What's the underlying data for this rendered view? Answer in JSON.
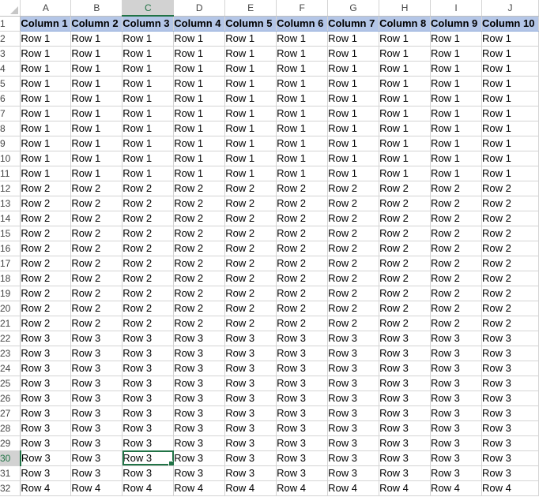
{
  "sheet": {
    "column_letters": [
      "A",
      "B",
      "C",
      "D",
      "E",
      "F",
      "G",
      "H",
      "I",
      "J"
    ],
    "active_column": "C",
    "active_row": 30,
    "selected_cell": "C30",
    "rows": [
      {
        "n": 1,
        "cells": [
          "Column 1",
          "Column 2",
          "Column 3",
          "Column 4",
          "Column 5",
          "Column 6",
          "Column 7",
          "Column 8",
          "Column 9",
          "Column 10"
        ]
      },
      {
        "n": 2,
        "cells": [
          "Row 1",
          "Row 1",
          "Row 1",
          "Row 1",
          "Row 1",
          "Row 1",
          "Row 1",
          "Row 1",
          "Row 1",
          "Row 1"
        ]
      },
      {
        "n": 3,
        "cells": [
          "Row 1",
          "Row 1",
          "Row 1",
          "Row 1",
          "Row 1",
          "Row 1",
          "Row 1",
          "Row 1",
          "Row 1",
          "Row 1"
        ]
      },
      {
        "n": 4,
        "cells": [
          "Row 1",
          "Row 1",
          "Row 1",
          "Row 1",
          "Row 1",
          "Row 1",
          "Row 1",
          "Row 1",
          "Row 1",
          "Row 1"
        ]
      },
      {
        "n": 5,
        "cells": [
          "Row 1",
          "Row 1",
          "Row 1",
          "Row 1",
          "Row 1",
          "Row 1",
          "Row 1",
          "Row 1",
          "Row 1",
          "Row 1"
        ]
      },
      {
        "n": 6,
        "cells": [
          "Row 1",
          "Row 1",
          "Row 1",
          "Row 1",
          "Row 1",
          "Row 1",
          "Row 1",
          "Row 1",
          "Row 1",
          "Row 1"
        ]
      },
      {
        "n": 7,
        "cells": [
          "Row 1",
          "Row 1",
          "Row 1",
          "Row 1",
          "Row 1",
          "Row 1",
          "Row 1",
          "Row 1",
          "Row 1",
          "Row 1"
        ]
      },
      {
        "n": 8,
        "cells": [
          "Row 1",
          "Row 1",
          "Row 1",
          "Row 1",
          "Row 1",
          "Row 1",
          "Row 1",
          "Row 1",
          "Row 1",
          "Row 1"
        ]
      },
      {
        "n": 9,
        "cells": [
          "Row 1",
          "Row 1",
          "Row 1",
          "Row 1",
          "Row 1",
          "Row 1",
          "Row 1",
          "Row 1",
          "Row 1",
          "Row 1"
        ]
      },
      {
        "n": 10,
        "cells": [
          "Row 1",
          "Row 1",
          "Row 1",
          "Row 1",
          "Row 1",
          "Row 1",
          "Row 1",
          "Row 1",
          "Row 1",
          "Row 1"
        ]
      },
      {
        "n": 11,
        "cells": [
          "Row 1",
          "Row 1",
          "Row 1",
          "Row 1",
          "Row 1",
          "Row 1",
          "Row 1",
          "Row 1",
          "Row 1",
          "Row 1"
        ]
      },
      {
        "n": 12,
        "cells": [
          "Row 2",
          "Row 2",
          "Row 2",
          "Row 2",
          "Row 2",
          "Row 2",
          "Row 2",
          "Row 2",
          "Row 2",
          "Row 2"
        ]
      },
      {
        "n": 13,
        "cells": [
          "Row 2",
          "Row 2",
          "Row 2",
          "Row 2",
          "Row 2",
          "Row 2",
          "Row 2",
          "Row 2",
          "Row 2",
          "Row 2"
        ]
      },
      {
        "n": 14,
        "cells": [
          "Row 2",
          "Row 2",
          "Row 2",
          "Row 2",
          "Row 2",
          "Row 2",
          "Row 2",
          "Row 2",
          "Row 2",
          "Row 2"
        ]
      },
      {
        "n": 15,
        "cells": [
          "Row 2",
          "Row 2",
          "Row 2",
          "Row 2",
          "Row 2",
          "Row 2",
          "Row 2",
          "Row 2",
          "Row 2",
          "Row 2"
        ]
      },
      {
        "n": 16,
        "cells": [
          "Row 2",
          "Row 2",
          "Row 2",
          "Row 2",
          "Row 2",
          "Row 2",
          "Row 2",
          "Row 2",
          "Row 2",
          "Row 2"
        ]
      },
      {
        "n": 17,
        "cells": [
          "Row 2",
          "Row 2",
          "Row 2",
          "Row 2",
          "Row 2",
          "Row 2",
          "Row 2",
          "Row 2",
          "Row 2",
          "Row 2"
        ]
      },
      {
        "n": 18,
        "cells": [
          "Row 2",
          "Row 2",
          "Row 2",
          "Row 2",
          "Row 2",
          "Row 2",
          "Row 2",
          "Row 2",
          "Row 2",
          "Row 2"
        ]
      },
      {
        "n": 19,
        "cells": [
          "Row 2",
          "Row 2",
          "Row 2",
          "Row 2",
          "Row 2",
          "Row 2",
          "Row 2",
          "Row 2",
          "Row 2",
          "Row 2"
        ]
      },
      {
        "n": 20,
        "cells": [
          "Row 2",
          "Row 2",
          "Row 2",
          "Row 2",
          "Row 2",
          "Row 2",
          "Row 2",
          "Row 2",
          "Row 2",
          "Row 2"
        ]
      },
      {
        "n": 21,
        "cells": [
          "Row 2",
          "Row 2",
          "Row 2",
          "Row 2",
          "Row 2",
          "Row 2",
          "Row 2",
          "Row 2",
          "Row 2",
          "Row 2"
        ]
      },
      {
        "n": 22,
        "cells": [
          "Row 3",
          "Row 3",
          "Row 3",
          "Row 3",
          "Row 3",
          "Row 3",
          "Row 3",
          "Row 3",
          "Row 3",
          "Row 3"
        ]
      },
      {
        "n": 23,
        "cells": [
          "Row 3",
          "Row 3",
          "Row 3",
          "Row 3",
          "Row 3",
          "Row 3",
          "Row 3",
          "Row 3",
          "Row 3",
          "Row 3"
        ]
      },
      {
        "n": 24,
        "cells": [
          "Row 3",
          "Row 3",
          "Row 3",
          "Row 3",
          "Row 3",
          "Row 3",
          "Row 3",
          "Row 3",
          "Row 3",
          "Row 3"
        ]
      },
      {
        "n": 25,
        "cells": [
          "Row 3",
          "Row 3",
          "Row 3",
          "Row 3",
          "Row 3",
          "Row 3",
          "Row 3",
          "Row 3",
          "Row 3",
          "Row 3"
        ]
      },
      {
        "n": 26,
        "cells": [
          "Row 3",
          "Row 3",
          "Row 3",
          "Row 3",
          "Row 3",
          "Row 3",
          "Row 3",
          "Row 3",
          "Row 3",
          "Row 3"
        ]
      },
      {
        "n": 27,
        "cells": [
          "Row 3",
          "Row 3",
          "Row 3",
          "Row 3",
          "Row 3",
          "Row 3",
          "Row 3",
          "Row 3",
          "Row 3",
          "Row 3"
        ]
      },
      {
        "n": 28,
        "cells": [
          "Row 3",
          "Row 3",
          "Row 3",
          "Row 3",
          "Row 3",
          "Row 3",
          "Row 3",
          "Row 3",
          "Row 3",
          "Row 3"
        ]
      },
      {
        "n": 29,
        "cells": [
          "Row 3",
          "Row 3",
          "Row 3",
          "Row 3",
          "Row 3",
          "Row 3",
          "Row 3",
          "Row 3",
          "Row 3",
          "Row 3"
        ]
      },
      {
        "n": 30,
        "cells": [
          "Row 3",
          "Row 3",
          "Row 3",
          "Row 3",
          "Row 3",
          "Row 3",
          "Row 3",
          "Row 3",
          "Row 3",
          "Row 3"
        ]
      },
      {
        "n": 31,
        "cells": [
          "Row 3",
          "Row 3",
          "Row 3",
          "Row 3",
          "Row 3",
          "Row 3",
          "Row 3",
          "Row 3",
          "Row 3",
          "Row 3"
        ]
      },
      {
        "n": 32,
        "cells": [
          "Row 4",
          "Row 4",
          "Row 4",
          "Row 4",
          "Row 4",
          "Row 4",
          "Row 4",
          "Row 4",
          "Row 4",
          "Row 4"
        ]
      }
    ]
  },
  "colors": {
    "header_fill": "#b4c6e7",
    "selection": "#217346",
    "gridline": "#d4d4d4"
  }
}
